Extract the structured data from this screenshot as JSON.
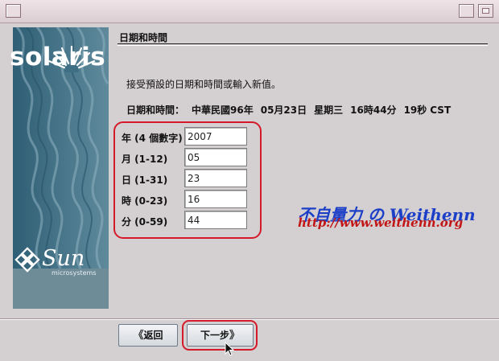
{
  "panel": {
    "title": "日期和時間"
  },
  "brand": {
    "logo_text": "solaris",
    "vendor": "Sun",
    "vendor_sub": "microsystems"
  },
  "instruction": "接受預設的日期和時間或輸入新值。",
  "current": {
    "label": "日期和時間：",
    "era": "中華民國",
    "year": "96年",
    "date": "05月23日",
    "weekday": "星期三",
    "time": "16時44分",
    "seconds": "19秒",
    "zone": "CST"
  },
  "fields": [
    {
      "label": "年 (4 個數字)",
      "value": "2007"
    },
    {
      "label": "月 (1-12)",
      "value": "05"
    },
    {
      "label": "日 (1-31)",
      "value": "23"
    },
    {
      "label": "時 (0-23)",
      "value": "16"
    },
    {
      "label": "分 (0-59)",
      "value": "44"
    }
  ],
  "watermark": {
    "title": "不自量力 の Weithenn",
    "url": "http://www.weithenn.org"
  },
  "buttons": {
    "back": "返回",
    "next": "下一步"
  },
  "colors": {
    "sidebar": "#3f6f85",
    "highlight": "#d41a2a",
    "watermark_blue": "#1b3fc7",
    "watermark_red": "#c21515"
  }
}
